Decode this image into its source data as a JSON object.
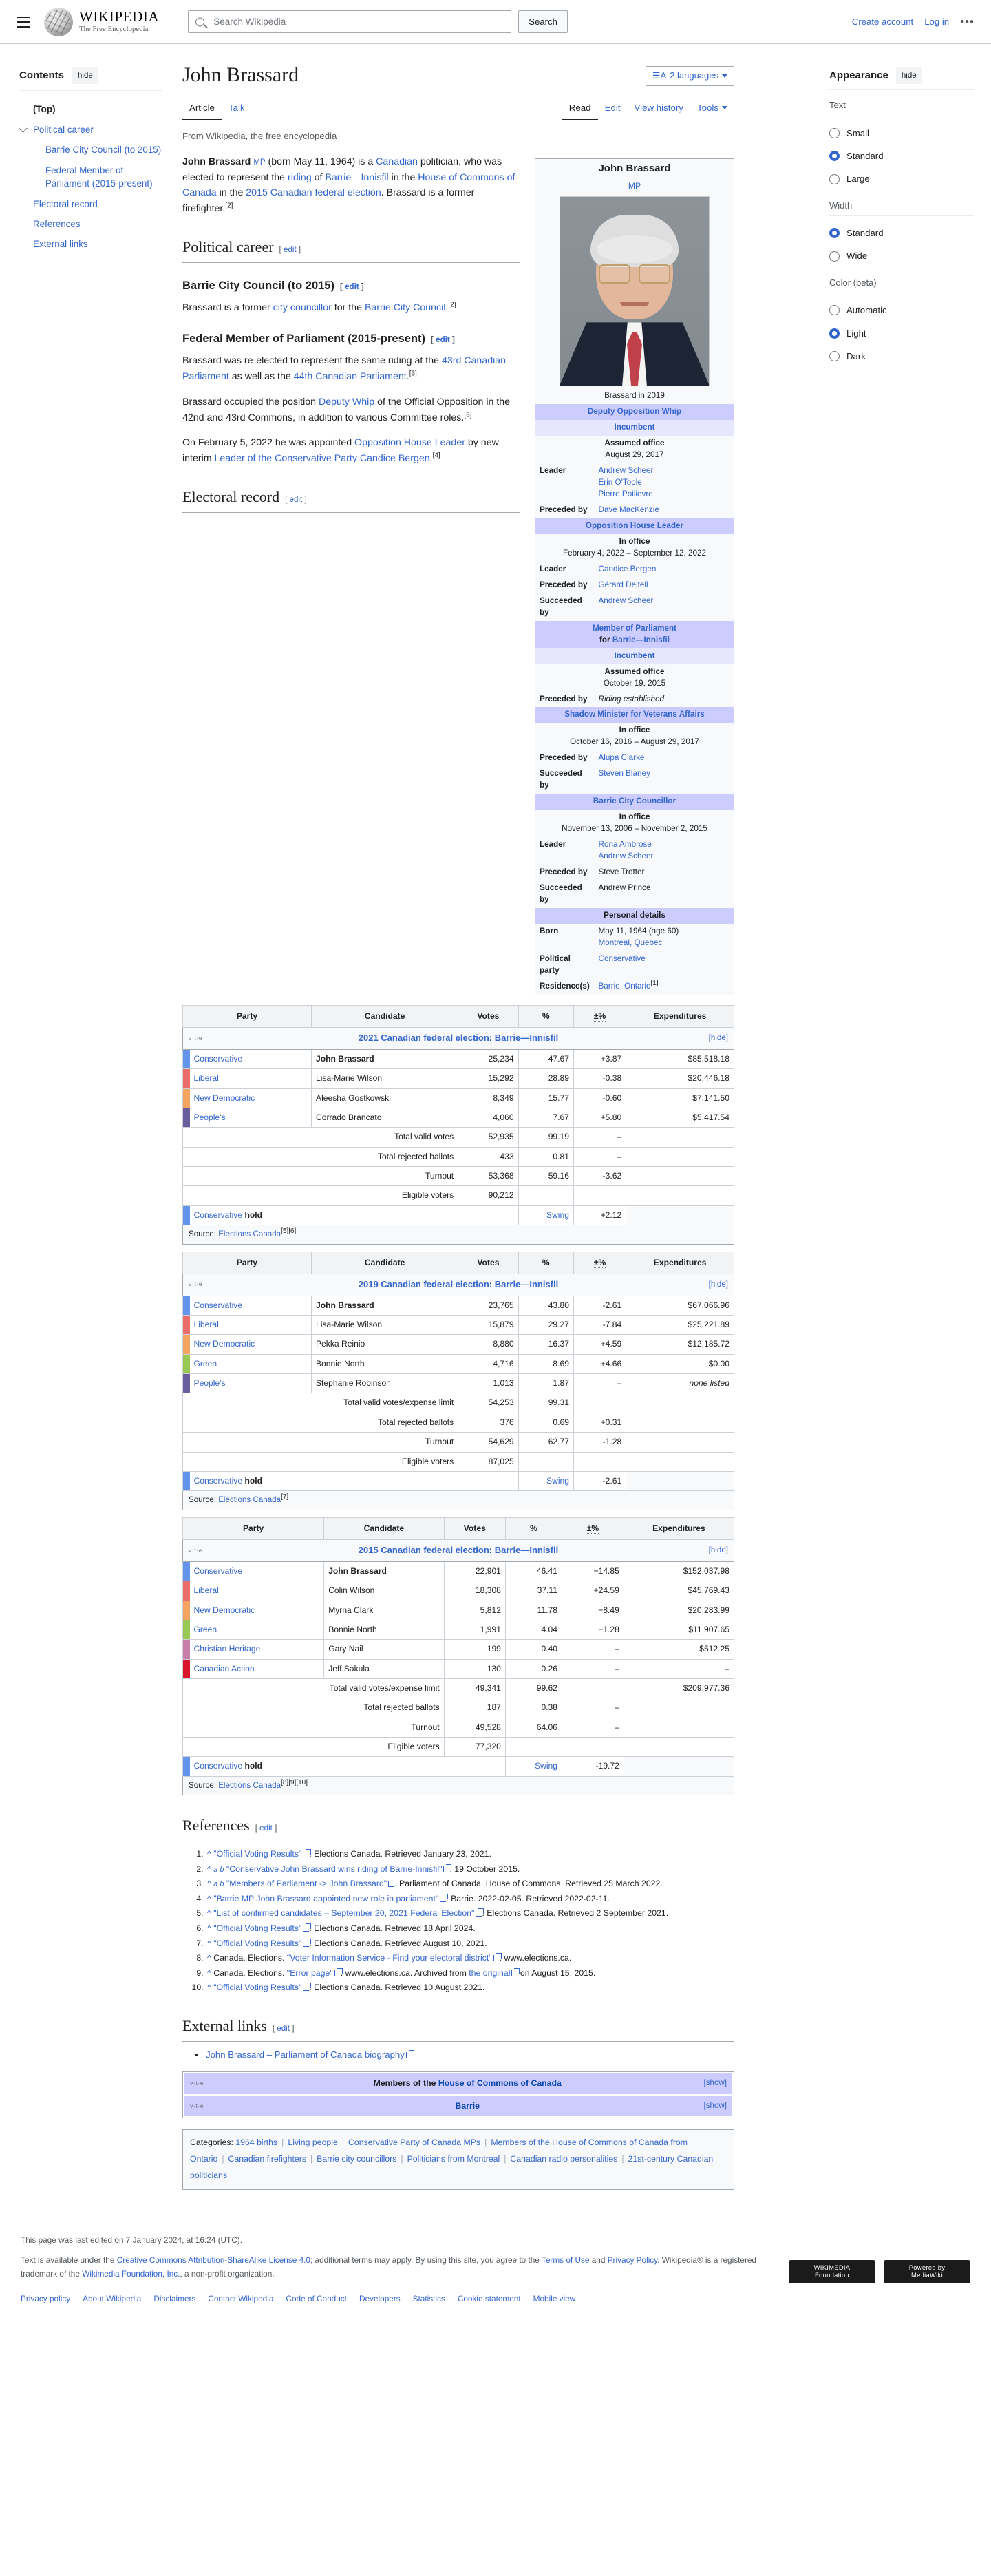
{
  "header": {
    "wordmark_line1": "WIKIPEDIA",
    "wordmark_line2": "The Free Encyclopedia",
    "search_placeholder": "Search Wikipedia",
    "search_value": "",
    "search_button": "Search",
    "create_account": "Create account",
    "login": "Log in",
    "more_dots": "•••"
  },
  "toc": {
    "heading": "Contents",
    "hide": "hide",
    "items": [
      {
        "label": "(Top)",
        "top": true
      },
      {
        "label": "Political career",
        "expandable": true
      },
      {
        "label": "Barrie City Council (to 2015)",
        "sub": true
      },
      {
        "label": "Federal Member of Parliament (2015-present)",
        "sub": true
      },
      {
        "label": "Electoral record"
      },
      {
        "label": "References"
      },
      {
        "label": "External links"
      }
    ]
  },
  "article": {
    "title": "John Brassard",
    "languages_button": "2 languages",
    "tabs_left": [
      {
        "label": "Article",
        "active": true
      },
      {
        "label": "Talk",
        "active": false
      }
    ],
    "tabs_right": [
      {
        "label": "Read",
        "active": true
      },
      {
        "label": "Edit",
        "active": false
      },
      {
        "label": "View history",
        "active": false
      },
      {
        "label": "Tools",
        "active": false,
        "caret": true
      }
    ],
    "from_line": "From Wikipedia, the free encyclopedia",
    "edit_label": "edit",
    "lead": {
      "name": "John Brassard",
      "mp": "MP",
      "t1": " (born May 11, 1964) is a ",
      "canadian": "Canadian",
      "t2": " politician, who was elected to represent the ",
      "riding": "riding",
      "t3": " of ",
      "barrie_innisfil": "Barrie—Innisfil",
      "t4": " in the ",
      "hoc": "House of Commons of Canada",
      "t5": " in the ",
      "election2015": "2015 Canadian federal election",
      "t6": ". Brassard is a former firefighter.",
      "ref": "[2]"
    },
    "sections": {
      "political_career": "Political career",
      "barrie_council": "Barrie City Council (to 2015)",
      "federal_mp": "Federal Member of Parliament (2015-present)",
      "electoral_record": "Electoral record",
      "references": "References",
      "external_links": "External links"
    },
    "barrie_para": {
      "t1": "Brassard is a former ",
      "l1": "city councillor",
      "t2": " for the ",
      "l2": "Barrie City Council",
      "t3": ".",
      "ref": "[2]"
    },
    "federal_para1": {
      "t1": "Brassard was re-elected to represent the same riding at the ",
      "l1": "43rd Canadian Parliament",
      "t2": " as well as the ",
      "l2": "44th Canadian Parliament",
      "t3": ".",
      "ref": "[3]"
    },
    "federal_para2": {
      "t1": "Brassard occupied the position ",
      "l1": "Deputy Whip",
      "t2": " of the Official Opposition in the 42nd and 43rd Commons, in addition to various Committee roles.",
      "ref": "[3]"
    },
    "federal_para3": {
      "t1": "On February 5, 2022 he was appointed ",
      "l1": "Opposition House Leader",
      "t2": " by new interim ",
      "l2": "Leader of the Conservative Party",
      "t3": " ",
      "l3": "Candice Bergen",
      "t4": ".",
      "ref": "[4]"
    }
  },
  "infobox": {
    "name": "John Brassard",
    "post_nominal": "MP",
    "caption": "Brassard in 2019",
    "offices": [
      {
        "title": "Deputy Opposition Whip",
        "status": "Incumbent",
        "term_label": "Assumed office",
        "term_value": "August 29, 2017",
        "rows": [
          {
            "label": "Leader",
            "values": [
              "Andrew Scheer",
              "Erin O'Toole",
              "Pierre Poilievre"
            ],
            "link": true
          },
          {
            "label": "Preceded by",
            "values": [
              "Dave MacKenzie"
            ],
            "link": true
          }
        ]
      },
      {
        "title": "Opposition House Leader",
        "term_label": "In office",
        "term_value": "February 4, 2022 – September 12, 2022",
        "rows": [
          {
            "label": "Leader",
            "values": [
              "Candice Bergen"
            ],
            "link": true
          },
          {
            "label": "Preceded by",
            "values": [
              "Gérard Deltell"
            ],
            "link": true
          },
          {
            "label": "Succeeded by",
            "values": [
              "Andrew Scheer"
            ],
            "link": true
          }
        ]
      },
      {
        "title": "Member of Parliament",
        "title2_prefix": "for ",
        "title2": "Barrie—Innisfil",
        "status": "Incumbent",
        "term_label": "Assumed office",
        "term_value": "October 19, 2015",
        "rows": [
          {
            "label": "Preceded by",
            "values": [
              "Riding established"
            ],
            "link": false,
            "italic": true
          }
        ]
      },
      {
        "title": "Shadow Minister for Veterans Affairs",
        "term_label": "In office",
        "term_value": "October 16, 2016 – August 29, 2017",
        "rows": [
          {
            "label": "Preceded by",
            "values": [
              "Alupa Clarke"
            ],
            "link": true
          },
          {
            "label": "Succeeded by",
            "values": [
              "Steven Blaney"
            ],
            "link": true
          }
        ]
      },
      {
        "title": "Barrie City Councillor",
        "term_label": "In office",
        "term_value": "November 13, 2006 – November 2, 2015",
        "rows": [
          {
            "label": "Leader",
            "values": [
              "Rona Ambrose",
              "Andrew Scheer"
            ],
            "link": true
          },
          {
            "label": "Preceded by",
            "values": [
              "Steve Trotter"
            ],
            "link": false
          },
          {
            "label": "Succeeded by",
            "values": [
              "Andrew Prince"
            ],
            "link": false
          }
        ]
      }
    ],
    "personal_details_header": "Personal details",
    "personal": [
      {
        "label": "Born",
        "values": [
          "May 11, 1964 (age 60)",
          "Montreal, Quebec"
        ],
        "link_index": 1
      },
      {
        "label": "Political party",
        "values": [
          "Conservative"
        ],
        "link_index": 0
      },
      {
        "label": "Residence(s)",
        "values": [
          "Barrie, Ontario"
        ],
        "link_index": 0,
        "ref": "[1]"
      }
    ]
  },
  "elections": [
    {
      "vte": "v·t·e",
      "title_year": "2021 Canadian federal election",
      "title_riding": "Barrie—Innisfil",
      "toggle": "[hide]",
      "columns": [
        "Party",
        "Candidate",
        "Votes",
        "%",
        "±%",
        "Expenditures"
      ],
      "rows": [
        {
          "color": "#6495ED",
          "party": "Conservative",
          "candidate": "John Brassard",
          "bold": true,
          "votes": "25,234",
          "pct": "47.67",
          "delta": "+3.87",
          "exp": "$85,518.18"
        },
        {
          "color": "#EA6D6A",
          "party": "Liberal",
          "candidate": "Lisa-Marie Wilson",
          "votes": "15,292",
          "pct": "28.89",
          "delta": "-0.38",
          "exp": "$20,446.18"
        },
        {
          "color": "#F4A460",
          "party": "New Democratic",
          "candidate": "Aleesha Gostkowski",
          "votes": "8,349",
          "pct": "15.77",
          "delta": "-0.60",
          "exp": "$7,141.50"
        },
        {
          "color": "#6A5D9E",
          "party": "People's",
          "candidate": "Corrado Brancato",
          "votes": "4,060",
          "pct": "7.67",
          "delta": "+5.80",
          "exp": "$5,417.54"
        }
      ],
      "totals": [
        {
          "label": "Total valid votes",
          "votes": "52,935",
          "pct": "99.19",
          "delta": "–",
          "exp": ""
        },
        {
          "label": "Total rejected ballots",
          "votes": "433",
          "pct": "0.81",
          "delta": "–",
          "exp": ""
        },
        {
          "label": "Turnout",
          "votes": "53,368",
          "pct": "59.16",
          "delta": "-3.62",
          "exp": ""
        },
        {
          "label": "Eligible voters",
          "votes": "90,212",
          "pct": "",
          "delta": "",
          "exp": ""
        }
      ],
      "result": {
        "color": "#6495ED",
        "party": "Conservative",
        "outcome": "hold",
        "swing_label": "Swing",
        "swing": "+2.12"
      },
      "source_prefix": "Source: ",
      "source_link": "Elections Canada",
      "source_refs": "[5][6]"
    },
    {
      "vte": "v·t·e",
      "title_year": "2019 Canadian federal election",
      "title_riding": "Barrie—Innisfil",
      "toggle": "[hide]",
      "columns": [
        "Party",
        "Candidate",
        "Votes",
        "%",
        "±%",
        "Expenditures"
      ],
      "rows": [
        {
          "color": "#6495ED",
          "party": "Conservative",
          "candidate": "John Brassard",
          "bold": true,
          "votes": "23,765",
          "pct": "43.80",
          "delta": "-2.61",
          "exp": "$67,066.96"
        },
        {
          "color": "#EA6D6A",
          "party": "Liberal",
          "candidate": "Lisa-Marie Wilson",
          "votes": "15,879",
          "pct": "29.27",
          "delta": "-7.84",
          "exp": "$25,221.89"
        },
        {
          "color": "#F4A460",
          "party": "New Democratic",
          "candidate": "Pekka Reinio",
          "votes": "8,880",
          "pct": "16.37",
          "delta": "+4.59",
          "exp": "$12,185.72"
        },
        {
          "color": "#99C955",
          "party": "Green",
          "candidate": "Bonnie North",
          "votes": "4,716",
          "pct": "8.69",
          "delta": "+4.66",
          "exp": "$0.00"
        },
        {
          "color": "#6A5D9E",
          "party": "People's",
          "candidate": "Stephanie Robinson",
          "votes": "1,013",
          "pct": "1.87",
          "delta": "–",
          "exp": "none listed",
          "exp_italic": true
        }
      ],
      "totals": [
        {
          "label": "Total valid votes/expense limit",
          "votes": "54,253",
          "pct": "99.31",
          "delta": "",
          "exp": ""
        },
        {
          "label": "Total rejected ballots",
          "votes": "376",
          "pct": "0.69",
          "delta": "+0.31",
          "exp": ""
        },
        {
          "label": "Turnout",
          "votes": "54,629",
          "pct": "62.77",
          "delta": "-1.28",
          "exp": ""
        },
        {
          "label": "Eligible voters",
          "votes": "87,025",
          "pct": "",
          "delta": "",
          "exp": ""
        }
      ],
      "result": {
        "color": "#6495ED",
        "party": "Conservative",
        "outcome": "hold",
        "swing_label": "Swing",
        "swing": "-2.61"
      },
      "source_prefix": "Source: ",
      "source_link": "Elections Canada",
      "source_refs": "[7]"
    },
    {
      "vte": "v·t·e",
      "title_year": "2015 Canadian federal election",
      "title_riding": "Barrie—Innisfil",
      "toggle": "[hide]",
      "columns": [
        "Party",
        "Candidate",
        "Votes",
        "%",
        "±%",
        "Expenditures"
      ],
      "rows": [
        {
          "color": "#6495ED",
          "party": "Conservative",
          "candidate": "John Brassard",
          "bold": true,
          "votes": "22,901",
          "pct": "46.41",
          "delta": "−14.85",
          "exp": "$152,037.98"
        },
        {
          "color": "#EA6D6A",
          "party": "Liberal",
          "candidate": "Colin Wilson",
          "votes": "18,308",
          "pct": "37.11",
          "delta": "+24.59",
          "exp": "$45,769.43"
        },
        {
          "color": "#F4A460",
          "party": "New Democratic",
          "candidate": "Myrna Clark",
          "votes": "5,812",
          "pct": "11.78",
          "delta": "−8.49",
          "exp": "$20,283.99"
        },
        {
          "color": "#99C955",
          "party": "Green",
          "candidate": "Bonnie North",
          "votes": "1,991",
          "pct": "4.04",
          "delta": "−1.28",
          "exp": "$11,907.65"
        },
        {
          "color": "#C87EA8",
          "party": "Christian Heritage",
          "candidate": "Gary Nail",
          "votes": "199",
          "pct": "0.40",
          "delta": "–",
          "exp": "$512.25"
        },
        {
          "color": "#D9152E",
          "party": "Canadian Action",
          "candidate": "Jeff Sakula",
          "votes": "130",
          "pct": "0.26",
          "delta": "–",
          "exp": "–"
        }
      ],
      "totals": [
        {
          "label": "Total valid votes/expense limit",
          "votes": "49,341",
          "pct": "99.62",
          "delta": "",
          "exp": "$209,977.36"
        },
        {
          "label": "Total rejected ballots",
          "votes": "187",
          "pct": "0.38",
          "delta": "–",
          "exp": ""
        },
        {
          "label": "Turnout",
          "votes": "49,528",
          "pct": "64.06",
          "delta": "–",
          "exp": ""
        },
        {
          "label": "Eligible voters",
          "votes": "77,320",
          "pct": "",
          "delta": "",
          "exp": ""
        }
      ],
      "result": {
        "color": "#6495ED",
        "party": "Conservative",
        "outcome": "hold",
        "swing_label": "Swing",
        "swing": "-19.72"
      },
      "source_prefix": "Source: ",
      "source_link": "Elections Canada",
      "source_refs": "[8][9][10]"
    }
  ],
  "references": [
    {
      "caret": "^",
      "ab": "",
      "link": "\"Official Voting Results\"",
      "rest": ". Elections Canada. Retrieved January 23, 2021."
    },
    {
      "caret": "^",
      "ab": "a b",
      "link": "\"Conservative John Brassard wins riding of Barrie-Innisfil\"",
      "rest": ". 19 October 2015."
    },
    {
      "caret": "^",
      "ab": "a b",
      "link": "\"Members of Parliament -> John Brassard\"",
      "rest": ". Parliament of Canada. House of Commons. Retrieved 25 March 2022."
    },
    {
      "caret": "^",
      "ab": "",
      "link": "\"Barrie MP John Brassard appointed new role in parliament\"",
      "rest": ". Barrie. 2022-02-05. Retrieved 2022-02-11."
    },
    {
      "caret": "^",
      "ab": "",
      "link": "\"List of confirmed candidates – September 20, 2021 Federal Election\"",
      "rest": ". Elections Canada. Retrieved 2 September 2021."
    },
    {
      "caret": "^",
      "ab": "",
      "link": "\"Official Voting Results\"",
      "rest": ". Elections Canada. Retrieved 18 April 2024."
    },
    {
      "caret": "^",
      "ab": "",
      "link": "\"Official Voting Results\"",
      "rest": ". Elections Canada. Retrieved August 10, 2021."
    },
    {
      "caret": "^",
      "ab": "",
      "prefix": "Canada, Elections. ",
      "link": "\"Voter Information Service - Find your electoral district\"",
      "rest": ". www.elections.ca."
    },
    {
      "caret": "^",
      "ab": "",
      "prefix": "Canada, Elections. ",
      "link": "\"Error page\"",
      "rest": ". www.elections.ca. Archived from ",
      "link2": "the original",
      "rest2": " on August 15, 2015."
    },
    {
      "caret": "^",
      "ab": "",
      "link": "\"Official Voting Results\"",
      "rest": ". Elections Canada. Retrieved 10 August 2021."
    }
  ],
  "external_links": [
    {
      "label": "John Brassard – Parliament of Canada biography"
    }
  ],
  "navboxes": [
    {
      "vte": "v·t·e",
      "prefix": "Members of the ",
      "link": "House of Commons of Canada",
      "toggle": "[show]"
    },
    {
      "vte": "v·t·e",
      "prefix": "",
      "link": "Barrie",
      "toggle": "[show]"
    }
  ],
  "categories": {
    "label": "Categories:",
    "items": [
      "1964 births",
      "Living people",
      "Conservative Party of Canada MPs",
      "Members of the House of Commons of Canada from Ontario",
      "Canadian firefighters",
      "Barrie city councillors",
      "Politicians from Montreal",
      "Canadian radio personalities",
      "21st-century Canadian politicians"
    ]
  },
  "appearance": {
    "heading": "Appearance",
    "hide": "hide",
    "groups": [
      {
        "label": "Text",
        "options": [
          {
            "label": "Small",
            "selected": false
          },
          {
            "label": "Standard",
            "selected": true
          },
          {
            "label": "Large",
            "selected": false
          }
        ]
      },
      {
        "label": "Width",
        "options": [
          {
            "label": "Standard",
            "selected": true
          },
          {
            "label": "Wide",
            "selected": false
          }
        ]
      },
      {
        "label": "Color (beta)",
        "options": [
          {
            "label": "Automatic",
            "selected": false
          },
          {
            "label": "Light",
            "selected": true
          },
          {
            "label": "Dark",
            "selected": false
          }
        ]
      }
    ]
  },
  "footer": {
    "last_edited": "This page was last edited on 7 January 2024, at 16:24 (UTC).",
    "license_pre": "Text is available under the ",
    "license_link": "Creative Commons Attribution-ShareAlike License 4.0",
    "license_mid": "; additional terms may apply. By using this site, you agree to the ",
    "terms": "Terms of Use",
    "and": " and ",
    "privacy": "Privacy Policy",
    "license_post": ". Wikipedia® is a registered trademark of the ",
    "wmf": "Wikimedia Foundation, Inc.",
    "license_end": ", a non-profit organization.",
    "links": [
      "Privacy policy",
      "About Wikipedia",
      "Disclaimers",
      "Contact Wikipedia",
      "Code of Conduct",
      "Developers",
      "Statistics",
      "Cookie statement",
      "Mobile view"
    ],
    "badge_wmf": "WIKIMEDIA\nFoundation",
    "badge_mw": "Powered by\nMediaWiki"
  }
}
